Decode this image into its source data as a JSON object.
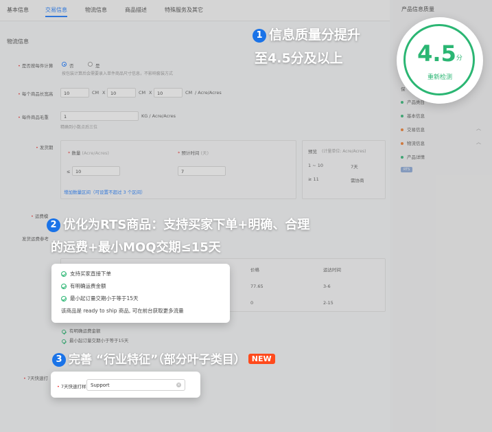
{
  "tabs": [
    "基本信息",
    "交易信息",
    "物流信息",
    "商品描述",
    "特殊服务及其它"
  ],
  "section_title": "物流信息",
  "form": {
    "package_weight_label": "是否按每件计算",
    "radio_yes": "否",
    "radio_no": "是",
    "package_hint": "按包装计算后会需要录入单件商品尺寸信息，不影响套装方式",
    "dims_label": "每个商品长宽高",
    "dim1": "10",
    "dim2": "10",
    "dim3": "10",
    "cm": "CM",
    "x": "X",
    "dim_unit": "/ Acre/Acres",
    "weight_label": "每件商品毛重",
    "weight_value": "1",
    "weight_unit": "KG / Acre/Acres",
    "weight_hint": "精确到小数点后三位",
    "lead_label": "发货期",
    "qty_header": "数量",
    "qty_header_unit": "(Acre/Acres)",
    "time_header": "预计时间",
    "time_header_unit": "(天)",
    "qty_prefix": "≤",
    "qty_value": "10",
    "time_value": "7",
    "add_range": "增加数量区间（可设置不超过 3 个区间）",
    "preview_title": "预览",
    "preview_unit": "(计量单位: Acre/Acres)",
    "preview_r1_qty": "1 ~ 10",
    "preview_r1_time": "7天",
    "preview_r2_qty": "≥ 11",
    "preview_r2_time": "需协商",
    "freight_label": "运费模",
    "ship_label": "发货运费参考",
    "col_price": "价格",
    "col_time": "运达时间",
    "row1_price": "77.65",
    "row1_time": "3-6",
    "row2_price": "0",
    "row2_time": "2-15",
    "under_1": "有明确运费金额",
    "under_2": "最小起订量交期小于等于15天",
    "rts_label": "7天快速打"
  },
  "sidebar": {
    "title": "产品信息质量",
    "cut_label": "保",
    "items": [
      {
        "label": "产品类目",
        "color": "#2bb673"
      },
      {
        "label": "基本信息",
        "color": "#2bb673"
      },
      {
        "label": "交易信息",
        "color": "#f07a2a"
      },
      {
        "label": "物流信息",
        "color": "#f07a2a"
      },
      {
        "label": "产品详情",
        "color": "#2bb673"
      }
    ],
    "badge": "RTS"
  },
  "score": {
    "value": "4.5",
    "unit": "分",
    "recheck": "重新检测"
  },
  "headline1": {
    "num": "1",
    "line1": "信息质量分提升",
    "line2": "至4.5分及以上"
  },
  "headline2": {
    "num": "2",
    "line1": "优化为RTS商品：支持买家下单+明确、合理",
    "line2": "的运费+最小MOQ交期≤15天"
  },
  "headline3": {
    "num": "3",
    "text": "完善 “行业特征”（部分叶子类目）",
    "badge": "NEW"
  },
  "rts_card": {
    "items": [
      "支持买家直接下单",
      "有明确运费金额",
      "最小起订量交期小于等于15天"
    ],
    "note": "该商品是 ready to ship 商品, 可在前台获取更多流量"
  },
  "industry_card": {
    "label": "7天快速打样:",
    "value": "Support"
  }
}
